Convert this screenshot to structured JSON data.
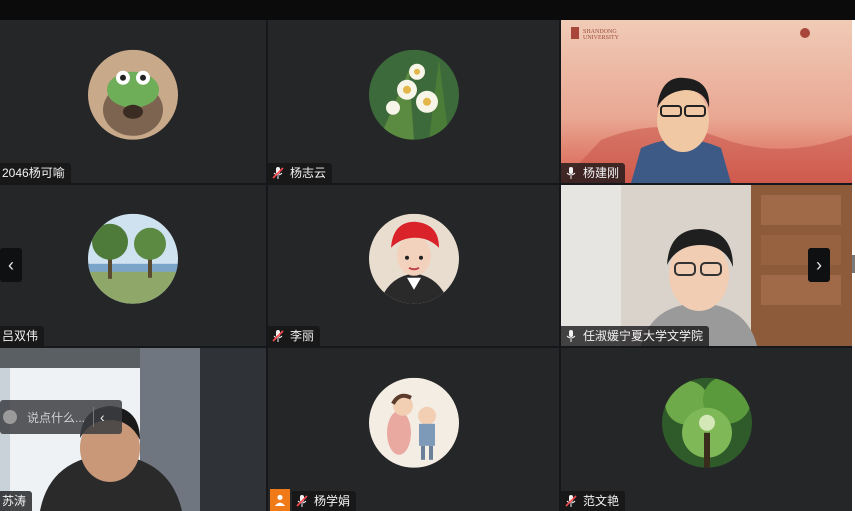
{
  "participants": [
    {
      "name": "2046杨可喻",
      "muted": false,
      "has_mic_icon": false
    },
    {
      "name": "杨志云",
      "muted": true,
      "has_mic_icon": true
    },
    {
      "name": "杨建刚",
      "muted": false,
      "has_mic_icon": true,
      "active_speaker": true
    },
    {
      "name": "吕双伟",
      "muted": false,
      "has_mic_icon": false
    },
    {
      "name": "李丽",
      "muted": true,
      "has_mic_icon": true
    },
    {
      "name": "任淑媛宁夏大学文学院",
      "muted": false,
      "has_mic_icon": true
    },
    {
      "name": "苏涛",
      "muted": false,
      "has_mic_icon": false
    },
    {
      "name": "杨学娟",
      "muted": true,
      "has_mic_icon": true
    },
    {
      "name": "范文艳",
      "muted": true,
      "has_mic_icon": true
    }
  ],
  "chat": {
    "placeholder": "说点什么..."
  },
  "nav": {
    "prev": "‹",
    "next": "›"
  },
  "colors": {
    "active_border": "#2fc27a",
    "tile_bg": "#252628",
    "host_badge": "#f07a18"
  }
}
